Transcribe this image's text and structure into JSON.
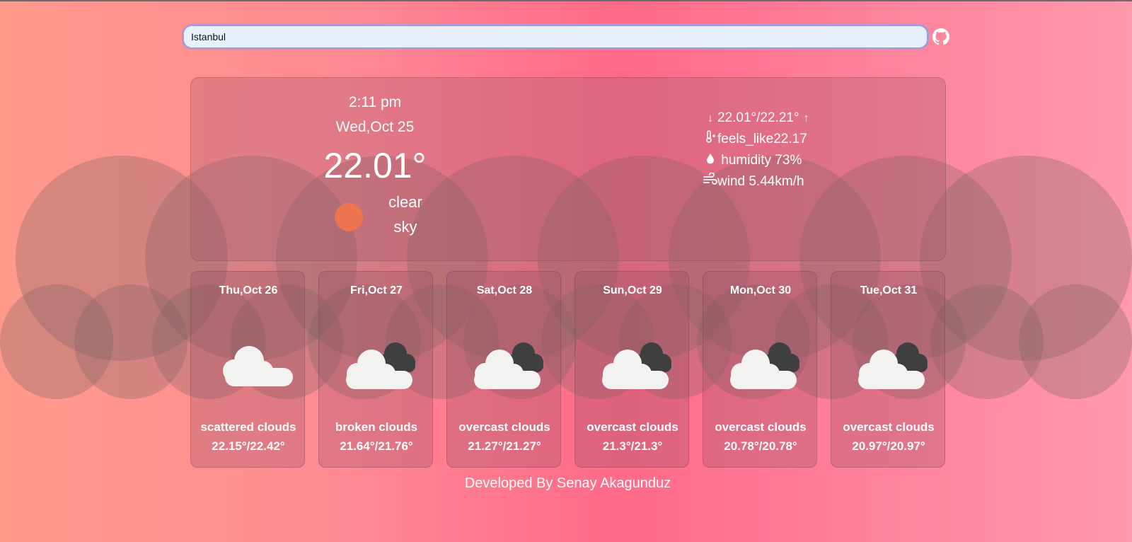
{
  "search": {
    "value": "Istanbul",
    "placeholder": ""
  },
  "header": {
    "github_icon": "github-icon"
  },
  "current": {
    "time": "2:11 pm",
    "date": "Wed,Oct 25",
    "temperature": "22.01°",
    "condition_line1": "clear",
    "condition_line2": "sky",
    "icon": "sun-icon",
    "min_max": "22.01°/22.21°",
    "feels_like": "feels_like22.17",
    "humidity": "humidity 73%",
    "wind": "wind 5.44km/h"
  },
  "forecast": [
    {
      "date": "Thu,Oct 26",
      "icon": "cloud-icon",
      "description": "scattered clouds",
      "range": "22.15°/22.42°"
    },
    {
      "date": "Fri,Oct 27",
      "icon": "broken-clouds-icon",
      "description": "broken clouds",
      "range": "21.64°/21.76°"
    },
    {
      "date": "Sat,Oct 28",
      "icon": "broken-clouds-icon",
      "description": "overcast clouds",
      "range": "21.27°/21.27°"
    },
    {
      "date": "Sun,Oct 29",
      "icon": "broken-clouds-icon",
      "description": "overcast clouds",
      "range": "21.3°/21.3°"
    },
    {
      "date": "Mon,Oct 30",
      "icon": "broken-clouds-icon",
      "description": "overcast clouds",
      "range": "20.78°/20.78°"
    },
    {
      "date": "Tue,Oct 31",
      "icon": "broken-clouds-icon",
      "description": "overcast clouds",
      "range": "20.97°/20.97°"
    }
  ],
  "footer": {
    "text": "Developed By Senay Akagunduz"
  },
  "colors": {
    "sun": "#ec7550",
    "input_border": "#a79bd8",
    "input_bg": "#e8f0fe",
    "cloud_light": "#f2f2f0",
    "cloud_dark": "#3f3f3f"
  }
}
